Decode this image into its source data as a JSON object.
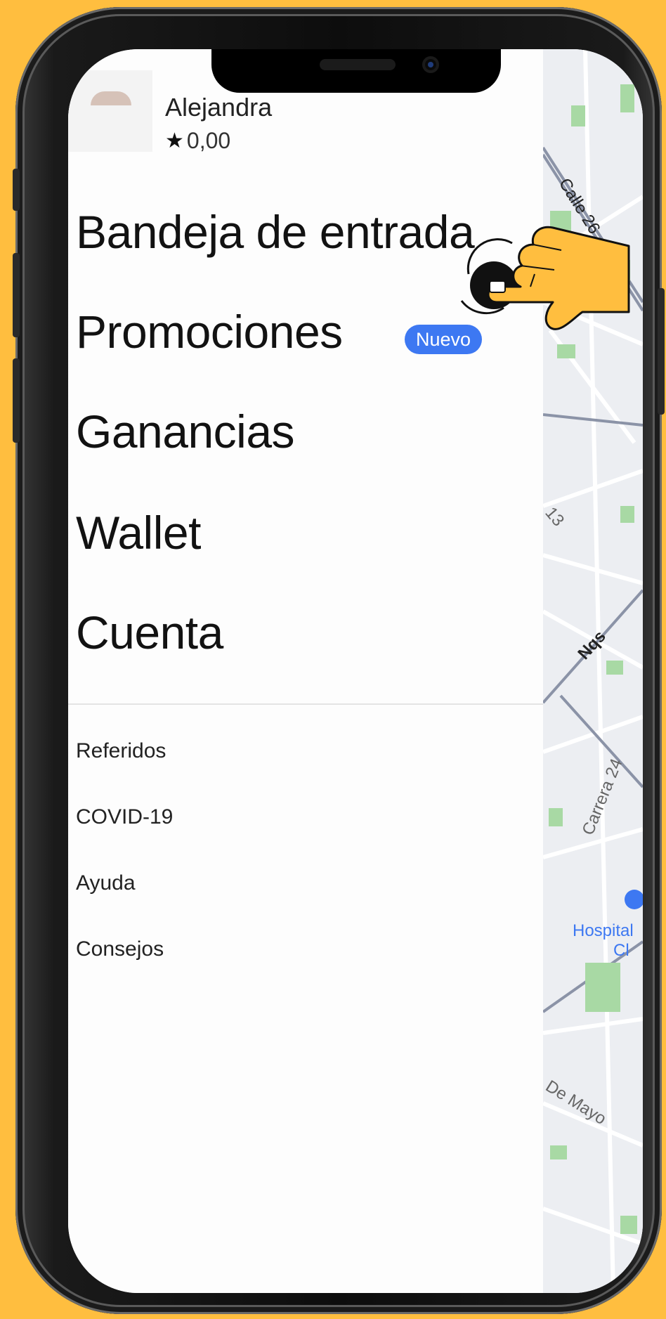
{
  "profile": {
    "name": "Alejandra",
    "rating": "0,00"
  },
  "menu": {
    "inbox": "Bandeja de entrada",
    "promotions": "Promociones",
    "promotions_badge": "Nuevo",
    "earnings": "Ganancias",
    "wallet": "Wallet",
    "account": "Cuenta"
  },
  "secondary_menu": {
    "referrals": "Referidos",
    "covid": "COVID-19",
    "help": "Ayuda",
    "tips": "Consejos"
  },
  "map_labels": {
    "street_calle26": "Calle 26",
    "street_13": "13",
    "street_nqs": "Nqs",
    "street_carrera24": "Carrera 24",
    "hospital": "Hospital",
    "hospital_sub": "Cl",
    "street_demayo": "De Mayo"
  },
  "colors": {
    "background": "#FFBE3F",
    "badge": "#3d78f2",
    "hand": "#FFBE3F"
  },
  "icons": [
    "star-icon",
    "hand-pointer-icon",
    "hospital-icon"
  ]
}
